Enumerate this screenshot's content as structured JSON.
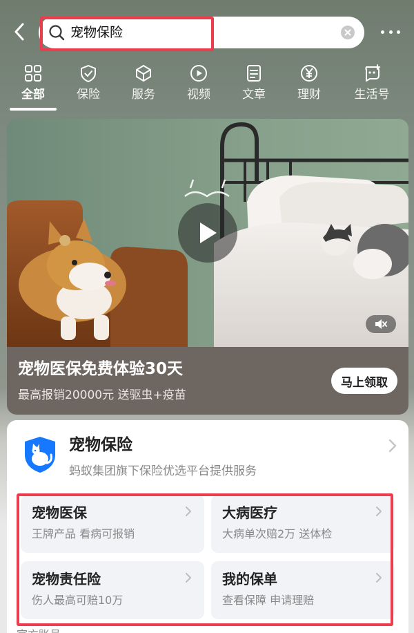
{
  "search": {
    "query": "宠物保险"
  },
  "tabs": [
    {
      "label": "全部",
      "icon": "grid-icon",
      "active": true
    },
    {
      "label": "保险",
      "icon": "shield-check-icon"
    },
    {
      "label": "服务",
      "icon": "cube-icon"
    },
    {
      "label": "视频",
      "icon": "play-circle-icon"
    },
    {
      "label": "文章",
      "icon": "document-icon"
    },
    {
      "label": "理财",
      "icon": "yen-circle-icon"
    },
    {
      "label": "生活号",
      "icon": "chat-bubble-icon"
    }
  ],
  "video": {
    "title": "宠物医保免费体验30天",
    "subtitle": "最高报销20000元 送驱虫+疫苗",
    "cta": "马上领取"
  },
  "insurance_panel": {
    "title": "宠物保险",
    "subtitle": "蚂蚁集团旗下保险优选平台提供服务",
    "services": [
      {
        "name": "宠物医保",
        "desc": "王牌产品 看病可报销"
      },
      {
        "name": "大病医疗",
        "desc": "大病单次赔2万 送体检"
      },
      {
        "name": "宠物责任险",
        "desc": "伤人最高可赔10万"
      },
      {
        "name": "我的保单",
        "desc": "查看保障 申请理赔"
      }
    ],
    "footer_peek": "官方账号"
  },
  "colors": {
    "highlight": "#ee3c4f",
    "brand_blue": "#1677ff"
  }
}
